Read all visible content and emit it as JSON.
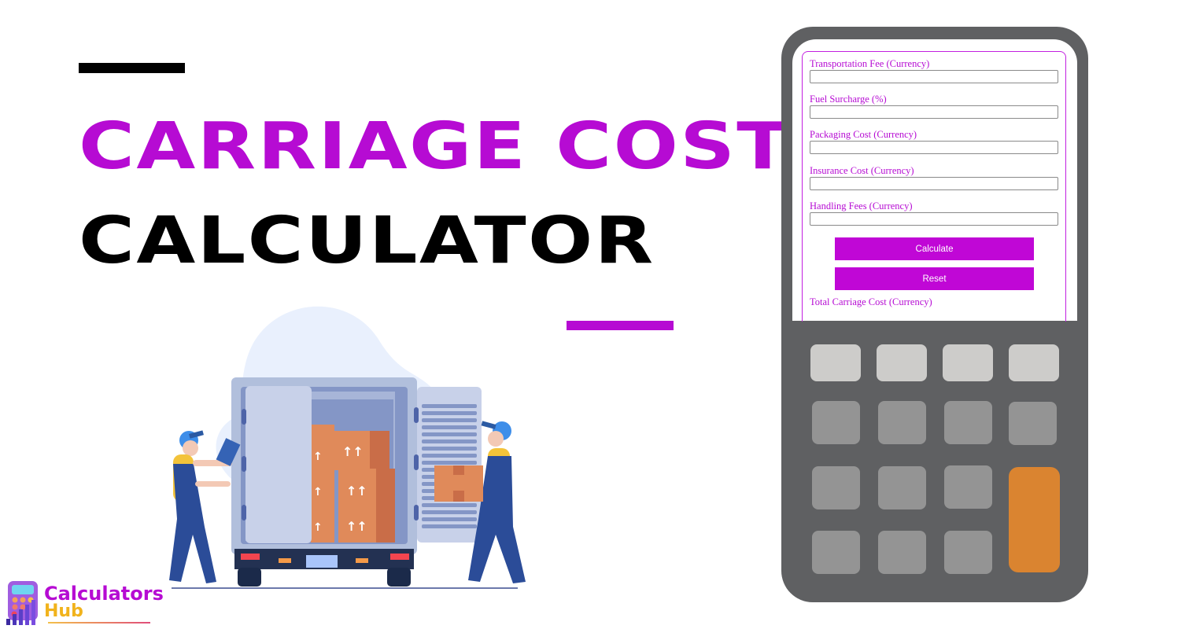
{
  "title": {
    "line1": "CARRIAGE COST",
    "line2": "CALCULATOR"
  },
  "colors": {
    "accent": "#b60bd3",
    "button": "#c007d6",
    "calculator_body": "#5f6062",
    "key_light": "#cdccca",
    "key_mid": "#949494",
    "key_orange": "#da8430"
  },
  "form": {
    "fields": [
      {
        "label": "Transportation Fee (Currency)",
        "value": ""
      },
      {
        "label": "Fuel Surcharge (%)",
        "value": ""
      },
      {
        "label": "Packaging Cost (Currency)",
        "value": ""
      },
      {
        "label": "Insurance Cost (Currency)",
        "value": ""
      },
      {
        "label": "Handling Fees (Currency)",
        "value": ""
      }
    ],
    "calculate_label": "Calculate",
    "reset_label": "Reset",
    "result_label": "Total Carriage Cost (Currency)"
  },
  "illustration": {
    "subject": "movers-loading-truck-illustration"
  },
  "logo": {
    "line1": "Calculators",
    "line2": "Hub",
    "icon": "calculator-chart-icon"
  }
}
